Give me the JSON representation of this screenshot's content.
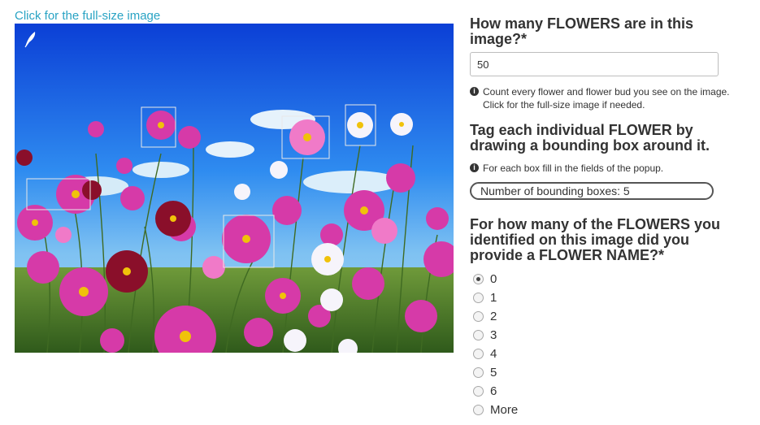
{
  "image_link": "Click for the full-size image",
  "question1": {
    "title": "How many FLOWERS are in this image?*",
    "value": "50",
    "help": "Count every flower and flower bud you see on the image. Click for the full-size image if needed."
  },
  "question2": {
    "title": "Tag each individual FLOWER by drawing a bounding box around it.",
    "help": "For each box fill in the fields of the popup.",
    "bbox_button": "Number of bounding boxes: 5"
  },
  "question3": {
    "title": "For how many of the FLOWERS you identified on this image did you provide a FLOWER NAME?*",
    "options": [
      "0",
      "1",
      "2",
      "3",
      "4",
      "5",
      "6",
      "More"
    ],
    "selected": "0"
  },
  "icons": {
    "info": "info-icon",
    "feather": "feather-icon"
  },
  "colors": {
    "link": "#29a3c4",
    "sky": "#1a73e8",
    "flower_magenta": "#d63aa8"
  }
}
